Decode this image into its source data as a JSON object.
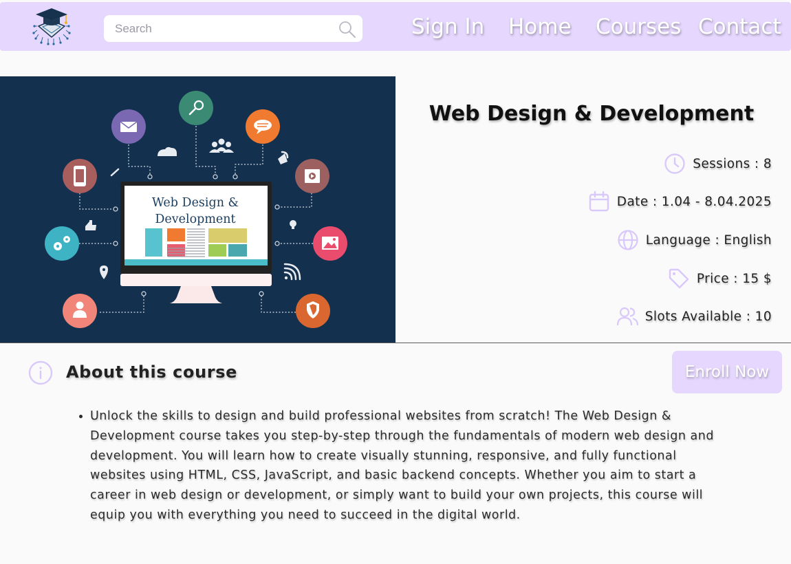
{
  "header": {
    "search_placeholder": "Search",
    "nav": {
      "sign_in": "Sign In",
      "home": "Home",
      "courses": "Courses",
      "contact": "Contact"
    }
  },
  "course": {
    "title": "Web Design & Development",
    "image_text_line1": "Web Design &",
    "image_text_line2": "Development",
    "info": {
      "sessions": "Sessions : 8",
      "date": "Date : 1.04 - 8.04.2025",
      "language": "Language : English",
      "price": "Price : 15 $",
      "slots": "Slots Available : 10"
    }
  },
  "about": {
    "title": "About this course",
    "enroll_label": "Enroll Now",
    "description": "Unlock the skills to design and build professional websites from scratch! The Web Design & Development course takes you step-by-step through the fundamentals of modern web design and development. You will learn how to create visually stunning, responsive, and fully functional websites using HTML, CSS, JavaScript, and basic backend concepts. Whether you aim to start a career in web design or development, or simply want to build your own projects, this course will equip you with everything you need to succeed in the digital world."
  },
  "icons": {
    "logo": "graduation-cap-circuit-logo",
    "search": "search-icon",
    "sessions": "clock-icon",
    "date": "calendar-icon",
    "language": "globe-icon",
    "price": "tag-icon",
    "slots": "users-icon",
    "about": "info-icon"
  },
  "colors": {
    "accent": "#e5d7fd",
    "icon_accent": "#d9c9fb",
    "hero_background": "#13304e"
  }
}
